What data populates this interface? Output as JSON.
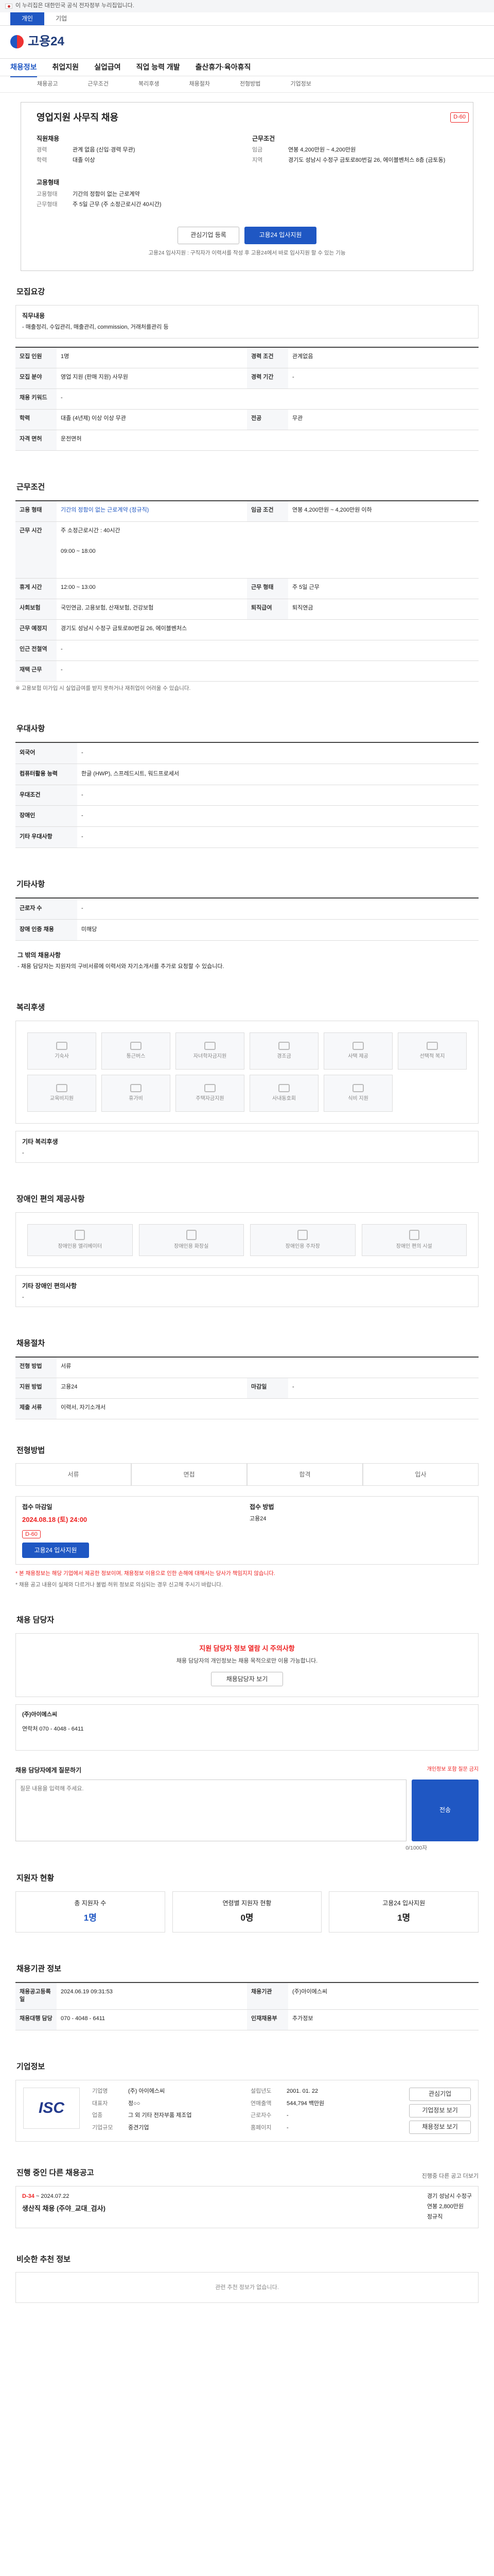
{
  "gov_banner": "이 누리집은 대한민국 공식 전자정부 누리집입니다.",
  "top_tabs": [
    "개인",
    "기업"
  ],
  "logo_text": "고용24",
  "nav": [
    "채용정보",
    "취업지원",
    "실업급여",
    "직업 능력 개발",
    "출산휴가·육아휴직"
  ],
  "subnav": [
    "채용공고",
    "근무조건",
    "복리후생",
    "채용절차",
    "전형방법",
    "기업정보"
  ],
  "job": {
    "title": "영업지원 사무직 채용",
    "dday": "D-60",
    "company_label": "직원채용",
    "left_rows": [
      {
        "k": "경력",
        "v": "관계 없음 (신입·경력 무관)"
      },
      {
        "k": "학력",
        "v": "대졸 이상"
      }
    ],
    "right_header": "근무조건",
    "right_rows": [
      {
        "k": "임금",
        "v": "연봉 4,200만원 ~ 4,200만원"
      },
      {
        "k": "지역",
        "v": "경기도 성남시 수정구 금토로80번길 26, 에이블벤처스 8층 (금토동)"
      }
    ],
    "type_label": "고용형태",
    "type_rows": [
      {
        "k": "고용형태",
        "v": "기간의 정함이 없는 근로계약"
      },
      {
        "k": "근무형태",
        "v": "주 5일 근무 (주 소정근로시간 40시간)"
      }
    ],
    "btn_interest": "관심기업 등록",
    "btn_apply": "고용24 입사지원",
    "apply_note": "고용24 입사지원 : 구직자가 이력서를 작성 후 고용24에서 바로 입사지원 할 수 있는 기능"
  },
  "summary": {
    "title": "모집요강",
    "duty_label": "직무내용",
    "duty": "- 매출정리, 수입관리, 매출관리, commission, 거래처를관리 등",
    "rows": [
      [
        "모집 인원",
        "1명",
        "경력 조건",
        "관계없음"
      ],
      [
        "모집 분야",
        "영업 지원 (판매 지원) 사무원",
        "경력 기간",
        "-"
      ],
      [
        "채용 키워드",
        "-",
        "",
        ""
      ],
      [
        "학력",
        "대졸 (4년제) 이상 이상 무관",
        "전공",
        "무관"
      ],
      [
        "자격 면허",
        "운전면허",
        "",
        ""
      ]
    ]
  },
  "conditions": {
    "title": "근무조건",
    "rows": [
      [
        "고용 형태",
        "기간의 정함이 없는 근로계약 (정규직)",
        "임금 조건",
        "연봉 4,200만원 ~ 4,200만원 이하"
      ],
      [
        "근무 시간",
        "주 소정근로시간 : 40시간",
        "",
        ""
      ],
      [
        "",
        "09:00 ~ 18:00",
        "",
        ""
      ],
      [
        "휴게 시간",
        "12:00 ~ 13:00",
        "근무 형태",
        "주 5일 근무"
      ],
      [
        "사회보험",
        "국민연금, 고용보험, 산재보험, 건강보험",
        "퇴직급여",
        "퇴직연금"
      ],
      [
        "근무 예정지",
        "경기도 성남시 수정구 금토로80번길 26, 에이블벤처스",
        "",
        ""
      ],
      [
        "인근 전철역",
        "-",
        "",
        ""
      ],
      [
        "재택 근무",
        "-",
        "",
        ""
      ]
    ],
    "footnote": "※ 고용보험 미가입 시 실업급여를 받지 못하거나 재취업이 어려울 수 있습니다."
  },
  "preference": {
    "title": "우대사항",
    "rows": [
      [
        "외국어",
        "-"
      ],
      [
        "컴퓨터활용 능력",
        "한글 (HWP), 스프레드시트, 워드프로세서"
      ],
      [
        "우대조건",
        "-"
      ],
      [
        "장애인",
        "-"
      ],
      [
        "기타 우대사항",
        "-"
      ]
    ]
  },
  "etc": {
    "title": "기타사항",
    "rows": [
      [
        "근로자 수",
        "-"
      ],
      [
        "장애 인증 채용",
        "미해당"
      ]
    ],
    "help_title": "그 밖의 채용사항",
    "help": "- 채용 담당자는 지원자의 구비서류에 이력서와 자기소개서를 추가로 요청할 수 있습니다."
  },
  "welfare": {
    "title": "복리후생",
    "items": [
      "기숙사",
      "통근버스",
      "자녀학자금지원",
      "경조금",
      "사택 제공",
      "선택적 복지",
      "교육비지원",
      "휴가비",
      "주택자금지원",
      "사내동호회",
      "식비 지원"
    ],
    "other_label": "기타 복리후생",
    "other": "-"
  },
  "disability": {
    "title": "장애인 편의 제공사항",
    "items": [
      "장애인용 엘리베이터",
      "장애인용 화장실",
      "장애인용 주차장",
      "장애인 편의 시설"
    ],
    "other_label": "기타 장애인 편의사항",
    "other": "-"
  },
  "process": {
    "title": "채용절차",
    "rows": [
      [
        "전형 방법",
        "서류"
      ],
      [
        "지원 방법",
        "고용24"
      ],
      [
        "마감일",
        "-"
      ],
      [
        "제출 서류",
        "이력서, 자기소개서"
      ]
    ]
  },
  "progress": {
    "title": "전형방법",
    "steps": [
      "서류",
      "면접",
      "합격",
      "입사"
    ]
  },
  "deadline": {
    "label": "접수 마감일",
    "date": "2024.08.18 (토) 24:00",
    "dday": "D-60",
    "method_label": "접수 방법",
    "method": "고용24",
    "btn": "고용24 입사지원"
  },
  "warning": [
    "* 본 채용정보는 해당 기업에서 제공한 정보이며, 채용정보 이용으로 인한 손해에 대해서는 당사가 책임지지 않습니다.",
    "* 채용 공고 내용이 실제와 다르거나 불법·허위 정보로 의심되는 경우 신고해 주시기 바랍니다."
  ],
  "contact": {
    "title": "채용 담당자",
    "alert": "지원 담당자 정보 열람 시 주의사항",
    "alert_body": "채용 담당자의 개인정보는 채용 목적으로만 이용 가능합니다.",
    "btn_view": "채용담당자 보기",
    "company": "(주)아이에스씨",
    "phone": "연락처 070 - 4048 - 6411"
  },
  "inquiry": {
    "title": "채용 담당자에게 질문하기",
    "note": "개인정보 포함 질문 금지",
    "placeholder": "질문 내용을 입력해 주세요.",
    "count": "0/1000자",
    "btn": "전송"
  },
  "stats": {
    "title": "지원자 현황",
    "items": [
      {
        "label": "총 지원자 수",
        "value": "1명"
      },
      {
        "label": "연령별 지원자 현황",
        "value": "0명"
      },
      {
        "label": "고용24 입사지원",
        "value": "1명"
      }
    ]
  },
  "registration": {
    "title": "채용기관 정보",
    "rows": [
      [
        "채용공고등록일",
        "2024.06.19 09:31:53",
        "채용기관",
        "(주)아이에스씨"
      ],
      [
        "채용대행 담당",
        "070 - 4048 - 6411",
        "인재채용부",
        "추가정보"
      ]
    ]
  },
  "company_info": {
    "title": "기업정보",
    "logo": "ISC",
    "rows": [
      [
        "기업명",
        "(주) 아이에스씨"
      ],
      [
        "대표자",
        "정○○"
      ],
      [
        "업종",
        "그 외 기타 전자부품 제조업"
      ],
      [
        "기업규모",
        "중견기업"
      ]
    ],
    "rows2": [
      [
        "설립년도",
        "2001. 01. 22"
      ],
      [
        "연매출액",
        "544,794 백만원"
      ],
      [
        "근로자수",
        "-"
      ],
      [
        "홈페이지",
        "-"
      ]
    ],
    "btns": [
      "관심기업",
      "기업정보 보기",
      "채용정보 보기"
    ]
  },
  "other_jobs": {
    "title": "진행 중인 다른 채용공고",
    "items": [
      {
        "dday": "D-34",
        "date": "~ 2024.07.22",
        "title": "생산직 채용 (주야_교대_검사)",
        "loc": "경기 성남시 수정구",
        "wage": "연봉 2,800만원",
        "type": "정규직"
      }
    ],
    "more": "진행중 다른 공고 더보기"
  },
  "similar": {
    "title": "비슷한 추천 정보",
    "empty": "관련 추천 정보가 없습니다."
  }
}
